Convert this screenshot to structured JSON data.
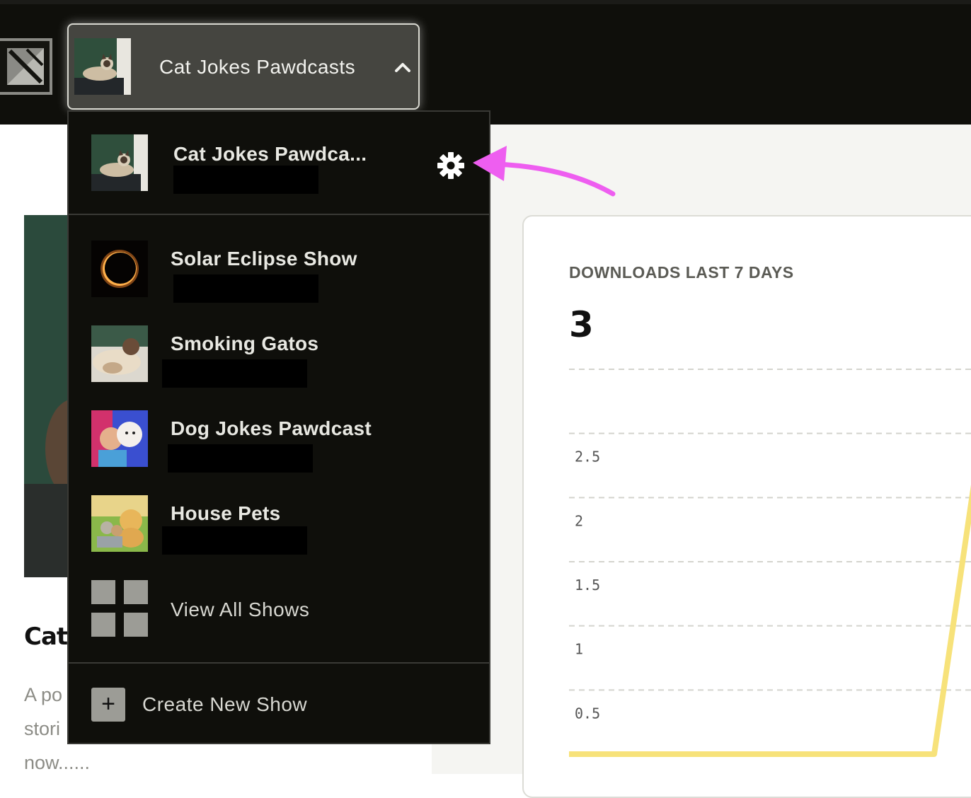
{
  "header": {
    "current_show": "Cat Jokes Pawdcasts"
  },
  "background": {
    "show_name_partial": "Cat",
    "description_partial": "A po\nstori\nnow......"
  },
  "dropdown": {
    "current": {
      "name": "Cat Jokes Pawdca..."
    },
    "shows": [
      {
        "name": "Solar Eclipse Show",
        "thumb": "eclipse"
      },
      {
        "name": "Smoking Gatos",
        "thumb": "cat-couch"
      },
      {
        "name": "Dog Jokes Pawdcast",
        "thumb": "boy-dog"
      },
      {
        "name": "House Pets",
        "thumb": "kittens-puppy"
      }
    ],
    "view_all_label": "View All Shows",
    "create_label": "Create New Show",
    "create_icon": "+"
  },
  "downloads": {
    "label": "DOWNLOADS LAST 7 DAYS",
    "value": "3"
  },
  "chart_data": {
    "type": "line",
    "title": "DOWNLOADS LAST 7 DAYS",
    "y_ticks": [
      "2.5",
      "2",
      "1.5",
      "1",
      "0.5"
    ],
    "ylim": [
      0,
      3
    ],
    "grid": true,
    "series": [
      {
        "values": [
          0,
          0,
          0,
          0,
          0,
          0,
          3
        ],
        "color": "#f7e27a"
      }
    ]
  },
  "colors": {
    "topbar": "#0f0f0b",
    "accent_arrow": "#ee5ef0",
    "chart_line": "#f7e27a"
  }
}
